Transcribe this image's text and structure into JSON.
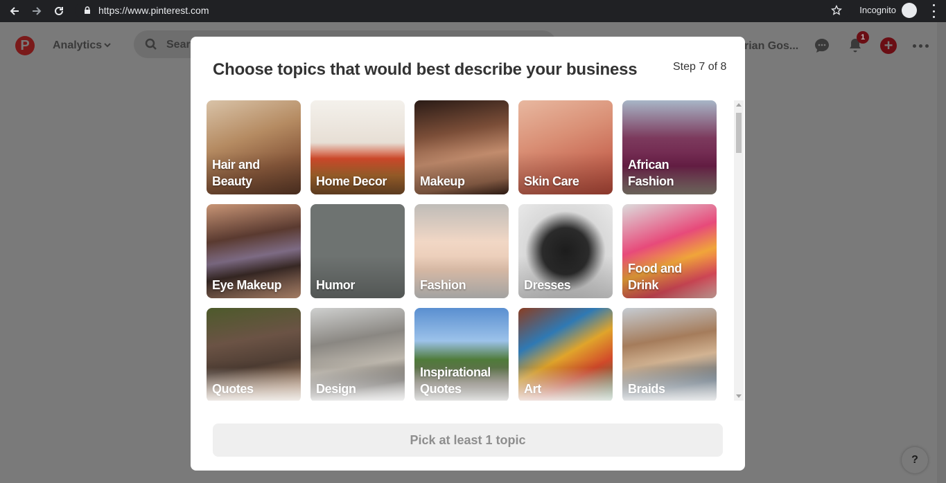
{
  "browser": {
    "url": "https://www.pinterest.com",
    "mode_label": "Incognito"
  },
  "header": {
    "analytics_label": "Analytics",
    "search_placeholder": "Searc",
    "user_name": "rian Gos...",
    "notification_count": "1",
    "logo_glyph": "P"
  },
  "modal": {
    "title": "Choose topics that would best describe your business",
    "step": "Step 7 of 8",
    "pick_button": "Pick at least 1 topic",
    "topics": [
      {
        "label": "Hair and\nBeauty",
        "icon": "hair-bun-photo",
        "bg": "linear-gradient(160deg,#d9c3a8 0%,#b58b62 40%,#8a5a3c 70%,#5e3a28 100%)"
      },
      {
        "label": "Home Decor",
        "icon": "dining-room-photo",
        "bg": "linear-gradient(180deg,#f4f1ec 0%,#e7dfd5 45%,#d24a2b 62%,#a9682d 80%,#7a4f2a 100%)"
      },
      {
        "label": "Makeup",
        "icon": "makeup-face-photo",
        "bg": "linear-gradient(170deg,#2a1b16 0%,#7b4e38 35%,#c28c6d 60%,#9a6a4f 85%,#3a2219 100%)"
      },
      {
        "label": "Skin Care",
        "icon": "skin-care-photo",
        "bg": "linear-gradient(160deg,#e8b8a0 0%,#d98f75 40%,#c96a55 70%,#b84a3a 100%)"
      },
      {
        "label": "African\nFashion",
        "icon": "african-fashion-photo",
        "bg": "linear-gradient(180deg,#a8b6c7 0%,#7c3a5d 40%,#6b1f48 70%,#8d8477 100%)"
      },
      {
        "label": "Eye Makeup",
        "icon": "eye-makeup-photo",
        "bg": "linear-gradient(170deg,#c89576 0%,#5a3a30 35%,#7d6b84 55%,#3a2a26 70%,#d7a383 100%)"
      },
      {
        "label": "Humor",
        "icon": "humor-placeholder",
        "bg": "#6e7371"
      },
      {
        "label": "Fashion",
        "icon": "fashion-photo",
        "bg": "linear-gradient(180deg,#bfbcb8 0%,#f1d7c5 40%,#e8c8b2 70%,#d9d8d6 100%)"
      },
      {
        "label": "Dresses",
        "icon": "dress-photo",
        "bg": "radial-gradient(ellipse at 50% 50%,#1c1c1c 0%,#2b2b2b 35%,#d9d9d9 60%,#e9e9e9 100%)"
      },
      {
        "label": "Food and\nDrink",
        "icon": "smoothie-photo",
        "bg": "linear-gradient(160deg,#dcdcdc 0%,#e74a7a 40%,#f0a53a 60%,#e84f5f 80%,#f4c0b8 100%)"
      },
      {
        "label": "Quotes",
        "icon": "elephant-photo",
        "bg": "linear-gradient(170deg,#4d5a2b 0%,#6b5345 35%,#4e3d33 60%,#b28a6a 85%,#d5b28e 100%)"
      },
      {
        "label": "Design",
        "icon": "abstract-design-photo",
        "bg": "linear-gradient(170deg,#cfd0cf 0%,#8a8782 35%,#bdb7ad 60%,#6f6b66 80%,#d8d8d6 100%)"
      },
      {
        "label": "Inspirational\nQuotes",
        "icon": "road-elephant-photo",
        "bg": "linear-gradient(180deg,#5a8fd0 0%,#9cc2ea 35%,#4f7b3a 55%,#7a7466 80%,#5c5a55 100%)"
      },
      {
        "label": "Art",
        "icon": "paintbrush-photo",
        "bg": "linear-gradient(150deg,#8a3d22 0%,#2f79b4 30%,#e0a42b 50%,#d24a2a 70%,#3b8e5a 100%)"
      },
      {
        "label": "Braids",
        "icon": "braids-photo",
        "bg": "linear-gradient(170deg,#c6ccd2 0%,#a57c5b 35%,#d2b392 55%,#5c6f80 80%,#98a4ae 100%)"
      }
    ]
  },
  "help_label": "?"
}
